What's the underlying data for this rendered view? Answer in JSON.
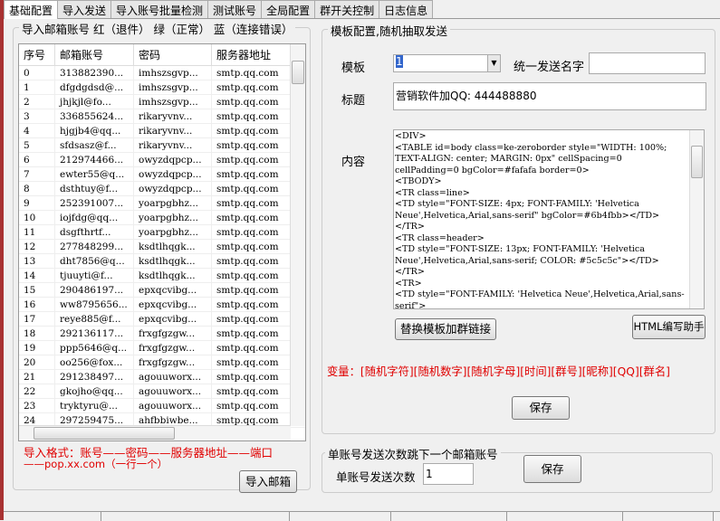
{
  "tabs": [
    "基础配置",
    "导入发送",
    "导入账号批量检测",
    "测试账号",
    "全局配置",
    "群开关控制",
    "日志信息"
  ],
  "left": {
    "group_title": "导入邮箱账号 红（退件） 绿（正常） 蓝（连接错误）",
    "columns": [
      "序号",
      "邮箱账号",
      "密码",
      "服务器地址"
    ],
    "rows": [
      [
        "0",
        "313882390...",
        "imhszsgvp...",
        "smtp.qq.com"
      ],
      [
        "1",
        "dfgdgdsd@...",
        "imhszsgvp...",
        "smtp.qq.com"
      ],
      [
        "2",
        "jhjkjl@fo...",
        "imhszsgvp...",
        "smtp.qq.com"
      ],
      [
        "3",
        "336855624...",
        "rikaryvnv...",
        "smtp.qq.com"
      ],
      [
        "4",
        "hjgjb4@qq...",
        "rikaryvnv...",
        "smtp.qq.com"
      ],
      [
        "5",
        "sfdsasz@f...",
        "rikaryvnv...",
        "smtp.qq.com"
      ],
      [
        "6",
        "212974466...",
        "owyzdqpcp...",
        "smtp.qq.com"
      ],
      [
        "7",
        "ewter55@q...",
        "owyzdqpcp...",
        "smtp.qq.com"
      ],
      [
        "8",
        "dsthtuy@f...",
        "owyzdqpcp...",
        "smtp.qq.com"
      ],
      [
        "9",
        "252391007...",
        "yoarpgbhz...",
        "smtp.qq.com"
      ],
      [
        "10",
        "iojfdg@qq...",
        "yoarpgbhz...",
        "smtp.qq.com"
      ],
      [
        "11",
        "dsgfthrtf...",
        "yoarpgbhz...",
        "smtp.qq.com"
      ],
      [
        "12",
        "277848299...",
        "ksdtlhqgk...",
        "smtp.qq.com"
      ],
      [
        "13",
        "dht7856@q...",
        "ksdtlhqgk...",
        "smtp.qq.com"
      ],
      [
        "14",
        "tjuuyti@f...",
        "ksdtlhqgk...",
        "smtp.qq.com"
      ],
      [
        "15",
        "290486197...",
        "epxqcvibg...",
        "smtp.qq.com"
      ],
      [
        "16",
        "ww8795656...",
        "epxqcvibg...",
        "smtp.qq.com"
      ],
      [
        "17",
        "reye885@f...",
        "epxqcvibg...",
        "smtp.qq.com"
      ],
      [
        "18",
        "292136117...",
        "frxgfgzgw...",
        "smtp.qq.com"
      ],
      [
        "19",
        "ppp5646@q...",
        "frxgfgzgw...",
        "smtp.qq.com"
      ],
      [
        "20",
        "oo256@fox...",
        "frxgfgzgw...",
        "smtp.qq.com"
      ],
      [
        "21",
        "291238497...",
        "agouuworx...",
        "smtp.qq.com"
      ],
      [
        "22",
        "gkojho@qq...",
        "agouuworx...",
        "smtp.qq.com"
      ],
      [
        "23",
        "tryktyru@...",
        "agouuworx...",
        "smtp.qq.com"
      ],
      [
        "24",
        "297259475...",
        "ahfbbiwbe...",
        "smtp.qq.com"
      ]
    ],
    "format_line1": "导入格式：账号——密码——服务器地址——端口",
    "format_line2": "——pop.xx.com（一行一个）",
    "import_button": "导入邮箱"
  },
  "template": {
    "group_title": "模板配置,随机抽取发送",
    "template_label": "模板",
    "template_value": "1",
    "sender_name_label": "统一发送名字",
    "sender_name_value": "",
    "title_label": "标题",
    "title_value": "营销软件加QQ: 444488880",
    "content_label": "内容",
    "content_value": "<DIV>\n<TABLE id=body class=ke-zeroborder style=\"WIDTH: 100%; TEXT-ALIGN: center; MARGIN: 0px\" cellSpacing=0 cellPadding=0 bgColor=#fafafa border=0>\n<TBODY>\n<TR class=line>\n<TD style=\"FONT-SIZE: 4px; FONT-FAMILY: 'Helvetica Neue',Helvetica,Arial,sans-serif\" bgColor=#6b4fbb></TD></TR>\n<TR class=header>\n<TD style=\"FONT-SIZE: 13px; FONT-FAMILY: 'Helvetica Neue',Helvetica,Arial,sans-serif; COLOR: #5c5c5c\"></TD></TR>\n<TR>\n<TD style=\"FONT-FAMILY: 'Helvetica Neue',Helvetica,Arial,sans-serif\">\n<TABLE class=\"wrapper ke-zeroborder\" style=\"WIDTH:",
    "replace_button": "替换模板加群链接",
    "html_helper_button": "HTML编写助手",
    "variables": "变量：[随机字符][随机数字][随机字母][时间][群号][昵称][QQ][群名]",
    "save_button": "保存"
  },
  "send_count": {
    "group_title": "单账号发送次数跳下一个邮箱账号",
    "label": "单账号发送次数",
    "value": "1",
    "save_button": "保存"
  }
}
